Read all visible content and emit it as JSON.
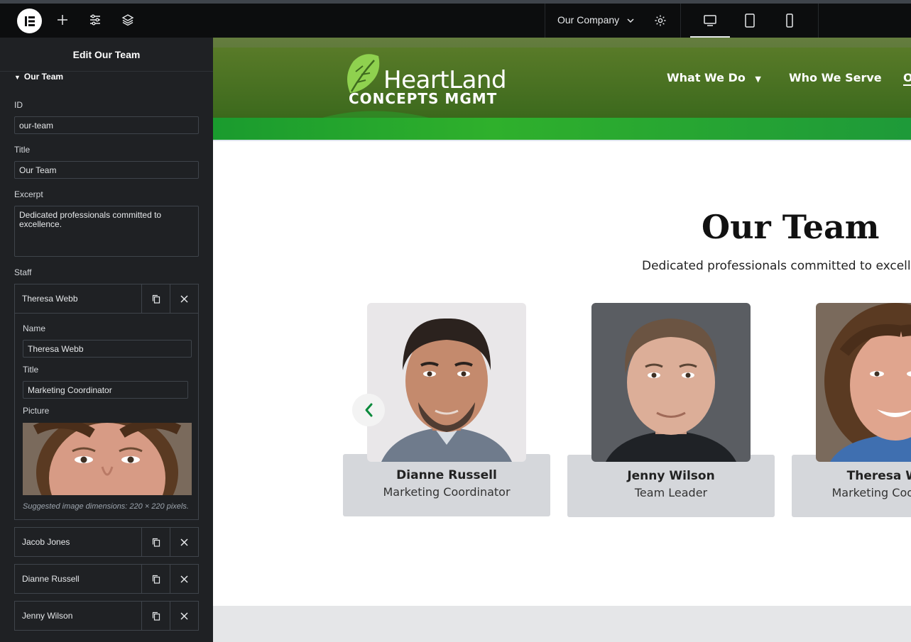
{
  "topbar": {
    "site_name": "Our Company",
    "icons": [
      "elementor-logo-icon",
      "plus-icon",
      "sliders-icon",
      "layers-icon",
      "chevron-down-icon",
      "gear-icon",
      "desktop-icon",
      "tablet-icon",
      "mobile-icon"
    ]
  },
  "panel": {
    "title": "Edit Our Team",
    "section": "Our Team",
    "fields": {
      "id_label": "ID",
      "id_value": "our-team",
      "title_label": "Title",
      "title_value": "Our Team",
      "excerpt_label": "Excerpt",
      "excerpt_value": "Dedicated professionals committed to excellence.",
      "staff_label": "Staff"
    },
    "staff": [
      {
        "name": "Theresa Webb"
      },
      {
        "name": "Jacob Jones"
      },
      {
        "name": "Dianne Russell"
      },
      {
        "name": "Jenny Wilson"
      }
    ],
    "open_item": {
      "name_label": "Name",
      "name_value": "Theresa Webb",
      "title_label": "Title",
      "title_value": "Marketing Coordinator",
      "picture_label": "Picture",
      "hint": "Suggested image dimensions: 220 × 220 pixels."
    }
  },
  "site": {
    "brand_line1": "HeartLand",
    "brand_line2": "CONCEPTS  MGMT",
    "nav": [
      {
        "label": "What We Do"
      },
      {
        "label": "Who We Serve"
      },
      {
        "label": "O"
      }
    ],
    "section_title": "Our Team",
    "section_subtitle": "Dedicated professionals committed to excellence.",
    "cards": [
      {
        "name": "Dianne Russell",
        "role": "Marketing Coordinator"
      },
      {
        "name": "Jenny Wilson",
        "role": "Team Leader"
      },
      {
        "name": "Theresa Webb",
        "role": "Marketing Coordinator"
      }
    ]
  },
  "colors": {
    "panel_bg": "#1f2124",
    "topbar_bg": "#0c0d0e",
    "header_green": "#3f6b1e",
    "accent_green": "#1a9b2e",
    "card_bg": "#d5d7db",
    "arrow_green": "#0b8a3c"
  }
}
